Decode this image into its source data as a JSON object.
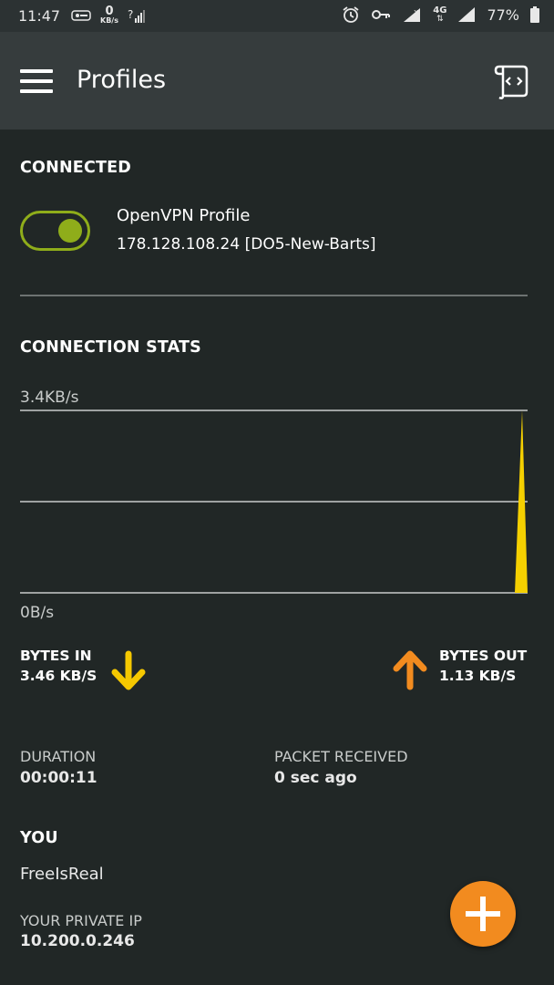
{
  "status_bar": {
    "time": "11:47",
    "net_speed_value": "0",
    "net_speed_unit": "KB/s",
    "network_type": "4G",
    "battery": "77%"
  },
  "app_bar": {
    "title": "Profiles"
  },
  "connected": {
    "header": "CONNECTED",
    "profile_name": "OpenVPN Profile",
    "server": "178.128.108.24 [DO5-New-Barts]",
    "toggle_on": true
  },
  "stats": {
    "header": "CONNECTION STATS",
    "bytes_in_label": "BYTES IN",
    "bytes_in_value": "3.46 KB/S",
    "bytes_out_label": "BYTES OUT",
    "bytes_out_value": "1.13 KB/S",
    "duration_label": "DURATION",
    "duration_value": "00:00:11",
    "packet_label": "PACKET RECEIVED",
    "packet_value": "0 sec ago"
  },
  "chart_data": {
    "type": "area",
    "y_max_label": "3.4KB/s",
    "y_min_label": "0B/s",
    "ylim": [
      0,
      3.4
    ],
    "series": [
      {
        "values": [
          0,
          0,
          0,
          0,
          0,
          0,
          0,
          0,
          0,
          0,
          0,
          0,
          0,
          0,
          0,
          0,
          0,
          0,
          0,
          0,
          0,
          0,
          0,
          0,
          0,
          0,
          0,
          0,
          0,
          0,
          0,
          0,
          0,
          0,
          0,
          0,
          0,
          0,
          0,
          0,
          0,
          0,
          0,
          0,
          0,
          0,
          0,
          0,
          0,
          0,
          0,
          0,
          0,
          0,
          0,
          0,
          0,
          0,
          0,
          3.4
        ]
      }
    ],
    "colors": {
      "in": "#f5d000"
    },
    "grid": true
  },
  "you": {
    "header": "YOU",
    "username": "FreeIsReal",
    "private_ip_label": "YOUR PRIVATE IP",
    "private_ip": "10.200.0.246"
  },
  "colors": {
    "accent_green": "#8fad1a",
    "in_arrow": "#f5c800",
    "out_arrow": "#f28b1f",
    "fab": "#f28b1f"
  }
}
